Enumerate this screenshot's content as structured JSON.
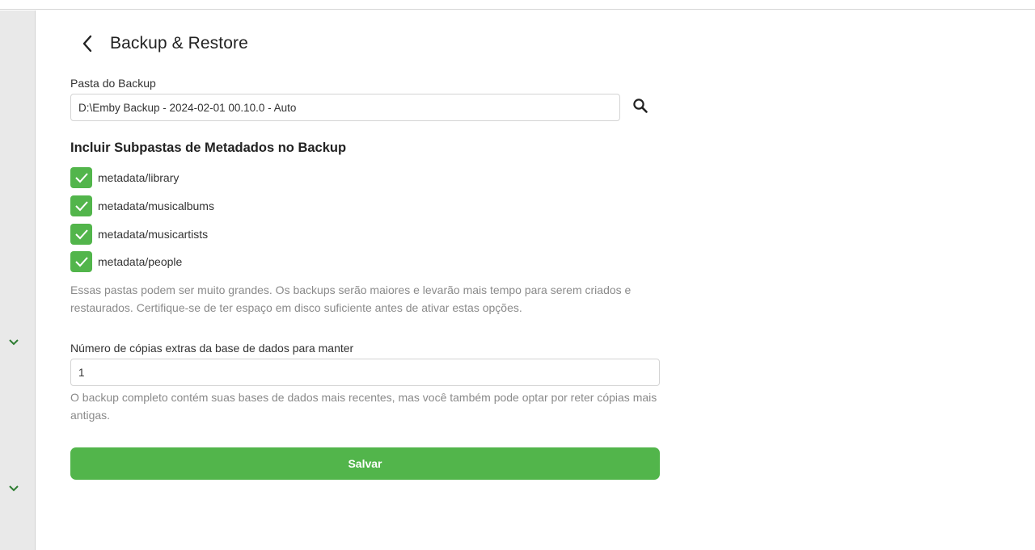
{
  "header": {
    "title": "Backup & Restore"
  },
  "backup_folder": {
    "label": "Pasta do Backup",
    "value": "D:\\Emby Backup - 2024-02-01 00.10.0 - Auto"
  },
  "metadata": {
    "title": "Incluir Subpastas de Metadados no Backup",
    "items": [
      {
        "label": "metadata/library",
        "checked": true
      },
      {
        "label": "metadata/musicalbums",
        "checked": true
      },
      {
        "label": "metadata/musicartists",
        "checked": true
      },
      {
        "label": "metadata/people",
        "checked": true
      }
    ],
    "help": "Essas pastas podem ser muito grandes. Os backups serão maiores e levarão mais tempo para serem criados e restaurados. Certifique-se de ter espaço em disco suficiente antes de ativar estas opções."
  },
  "db_copies": {
    "label": "Número de cópias extras da base de dados para manter",
    "value": "1",
    "help": "O backup completo contém suas bases de dados mais recentes, mas você também pode optar por reter cópias mais antigas."
  },
  "save_label": "Salvar",
  "colors": {
    "accent": "#52b54b",
    "sidebar_chevron": "#2e7d32"
  },
  "icons": {
    "back": "chevron-left-icon",
    "search": "search-icon",
    "check": "check-icon",
    "sidebar": "chevron-down-icon"
  }
}
